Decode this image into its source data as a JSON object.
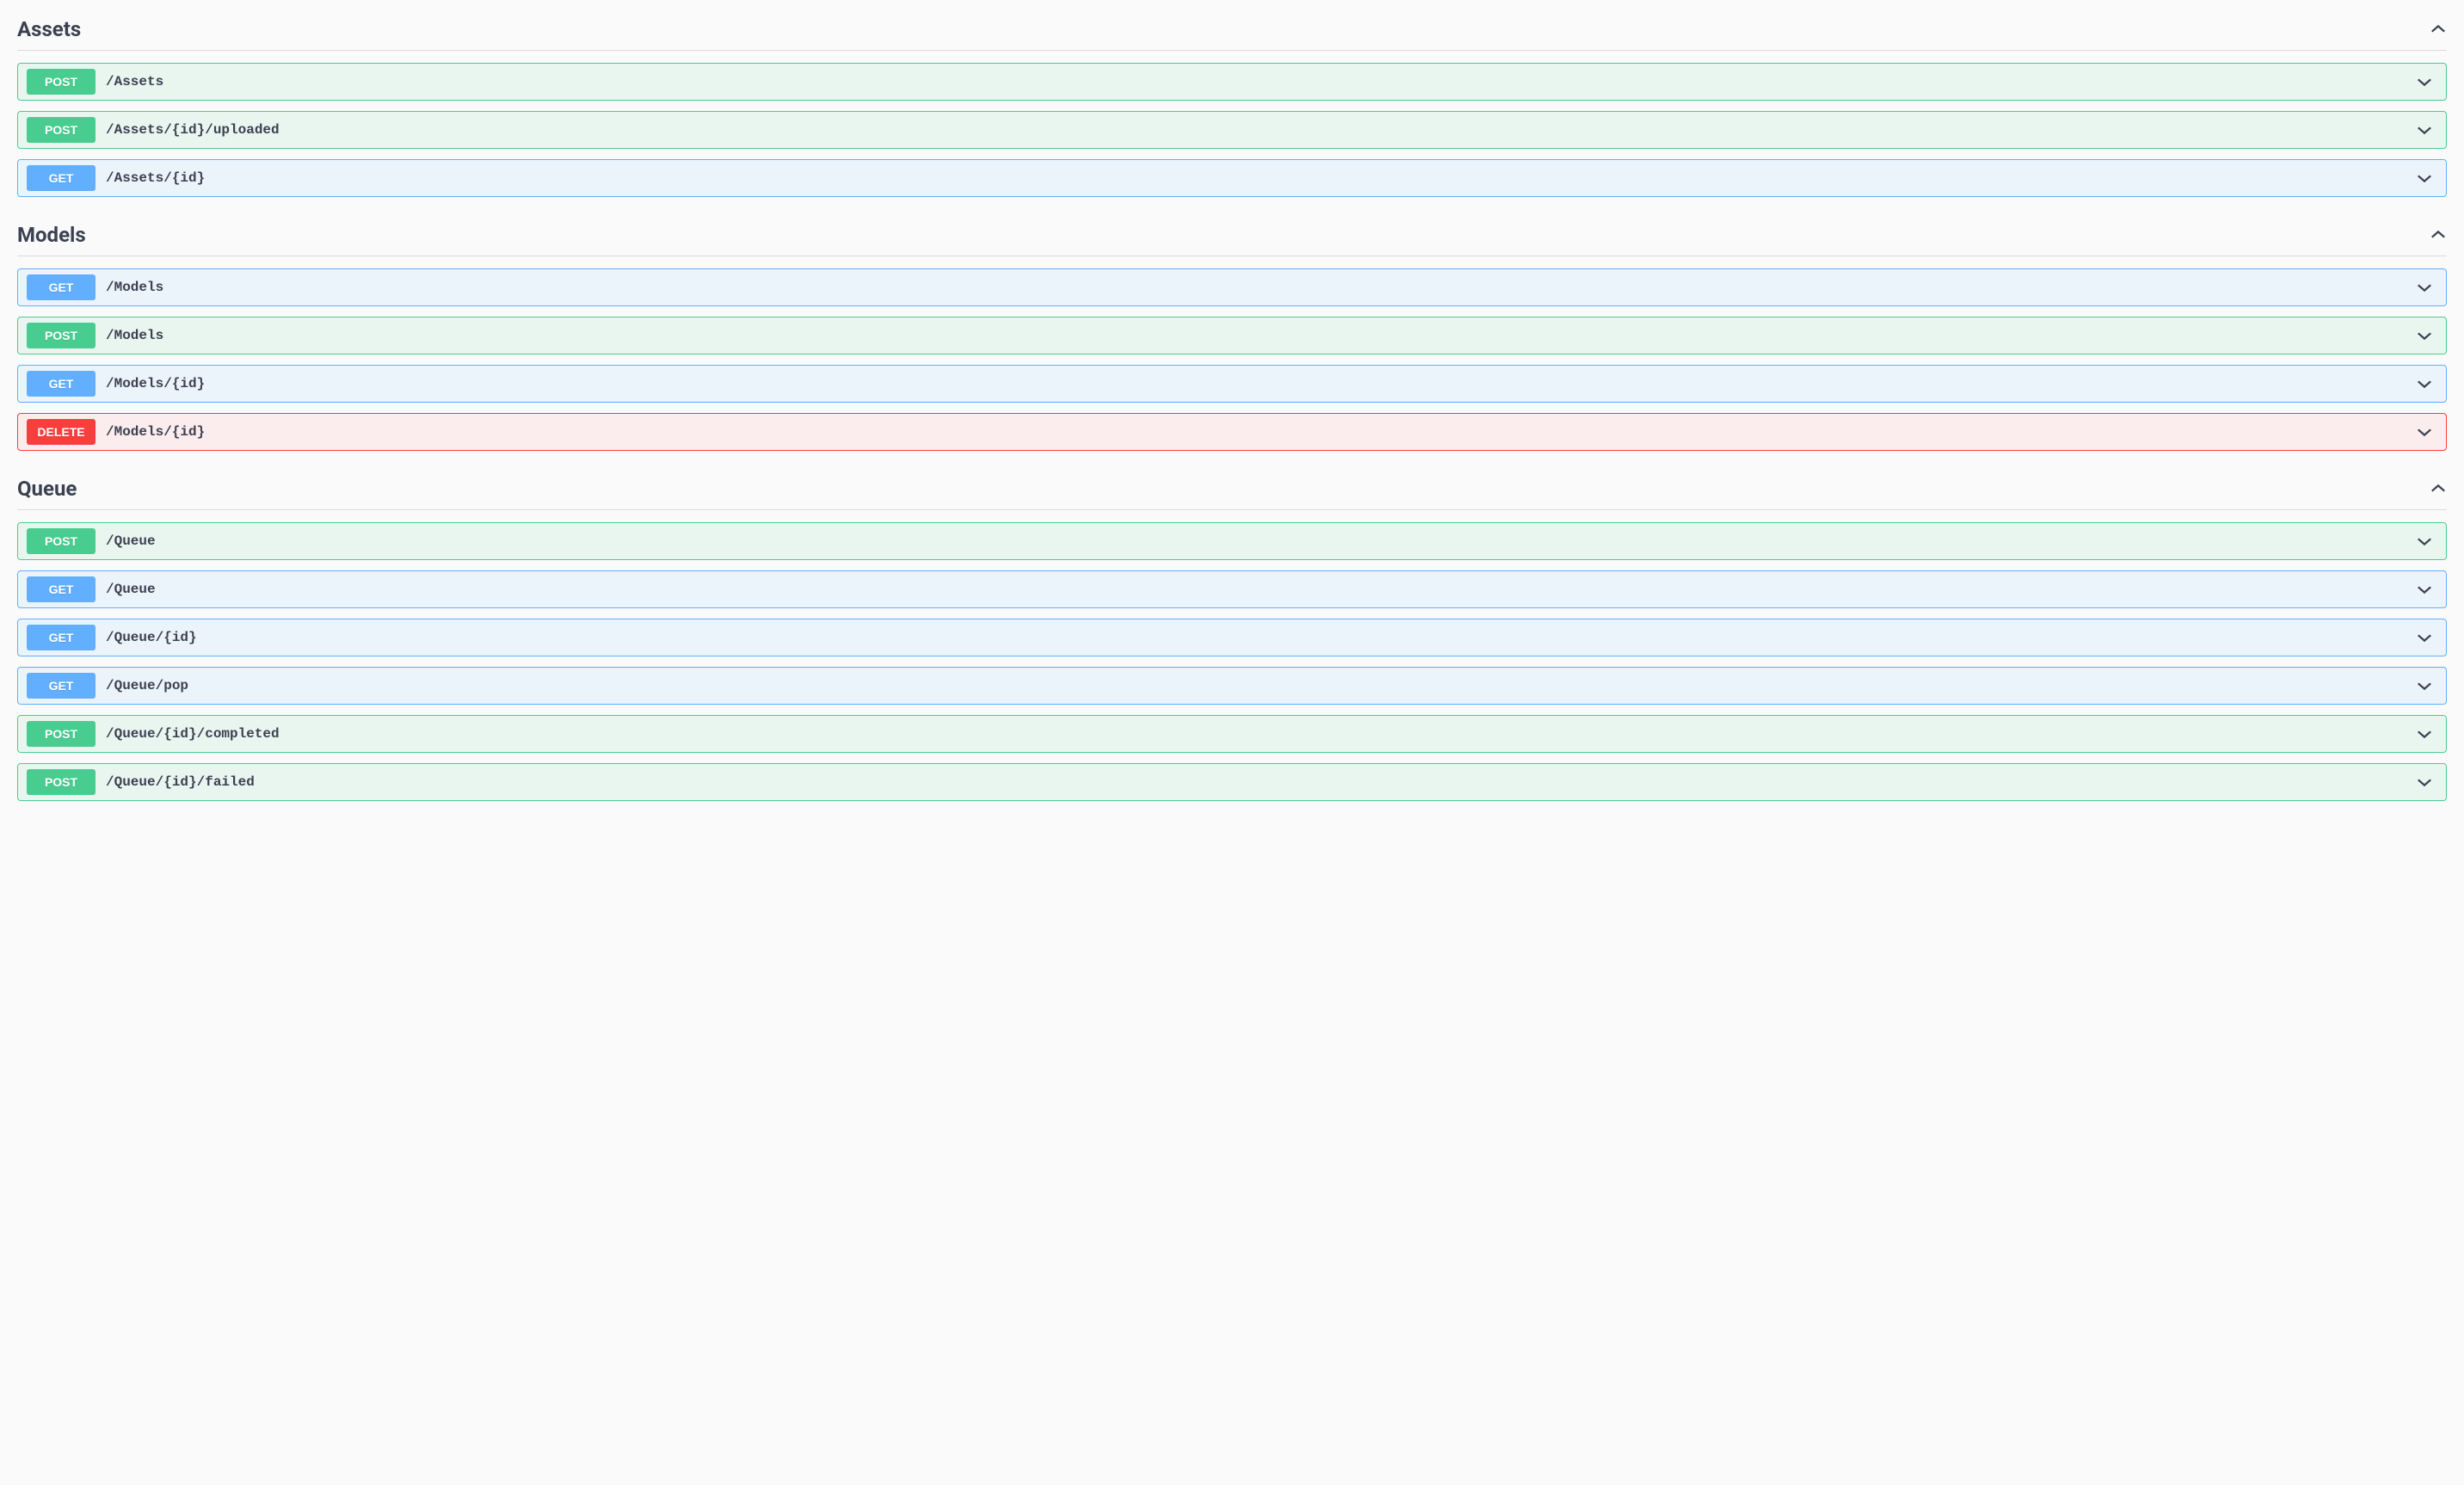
{
  "sections": [
    {
      "title": "Assets",
      "endpoints": [
        {
          "method": "POST",
          "path": "/Assets"
        },
        {
          "method": "POST",
          "path": "/Assets/{id}/uploaded"
        },
        {
          "method": "GET",
          "path": "/Assets/{id}"
        }
      ]
    },
    {
      "title": "Models",
      "endpoints": [
        {
          "method": "GET",
          "path": "/Models"
        },
        {
          "method": "POST",
          "path": "/Models"
        },
        {
          "method": "GET",
          "path": "/Models/{id}"
        },
        {
          "method": "DELETE",
          "path": "/Models/{id}"
        }
      ]
    },
    {
      "title": "Queue",
      "endpoints": [
        {
          "method": "POST",
          "path": "/Queue"
        },
        {
          "method": "GET",
          "path": "/Queue"
        },
        {
          "method": "GET",
          "path": "/Queue/{id}"
        },
        {
          "method": "GET",
          "path": "/Queue/pop"
        },
        {
          "method": "POST",
          "path": "/Queue/{id}/completed"
        },
        {
          "method": "POST",
          "path": "/Queue/{id}/failed"
        }
      ]
    }
  ]
}
